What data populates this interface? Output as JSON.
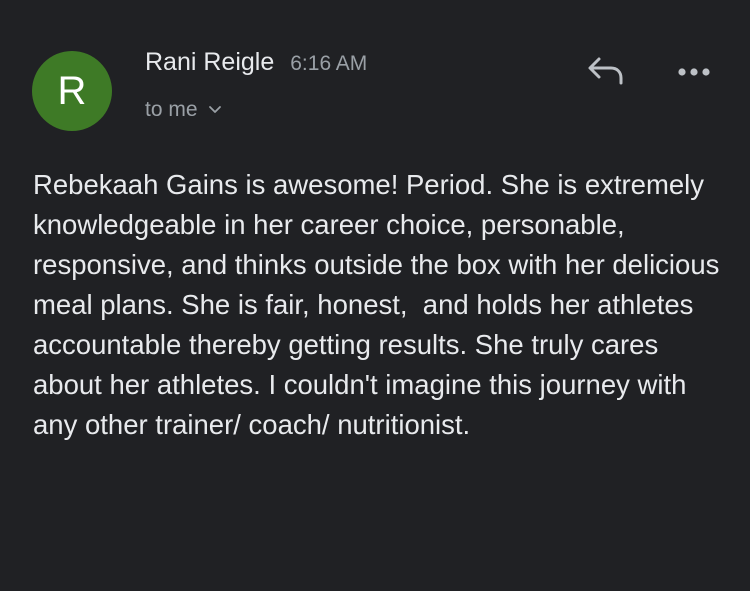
{
  "message": {
    "sender": {
      "avatar_initial": "R",
      "avatar_color": "#3e7a26",
      "name": "Rani Reigle",
      "time": "6:16 AM"
    },
    "recipient_label": "to me",
    "actions": {
      "reply_icon": "reply-icon",
      "more_icon": "more-options-icon",
      "expand_icon": "chevron-down-icon"
    },
    "body": "Rebekaah Gains is awesome! Period. She is extremely knowledgeable in her career choice, personable, responsive, and thinks outside the box with her delicious meal plans. She is fair, honest,  and holds her athletes accountable thereby getting results. She truly cares about her athletes. I couldn't imagine this journey with any other trainer/ coach/ nutritionist."
  },
  "colors": {
    "background": "#202124",
    "primary_text": "#e8eaed",
    "secondary_text": "#9aa0a6"
  }
}
